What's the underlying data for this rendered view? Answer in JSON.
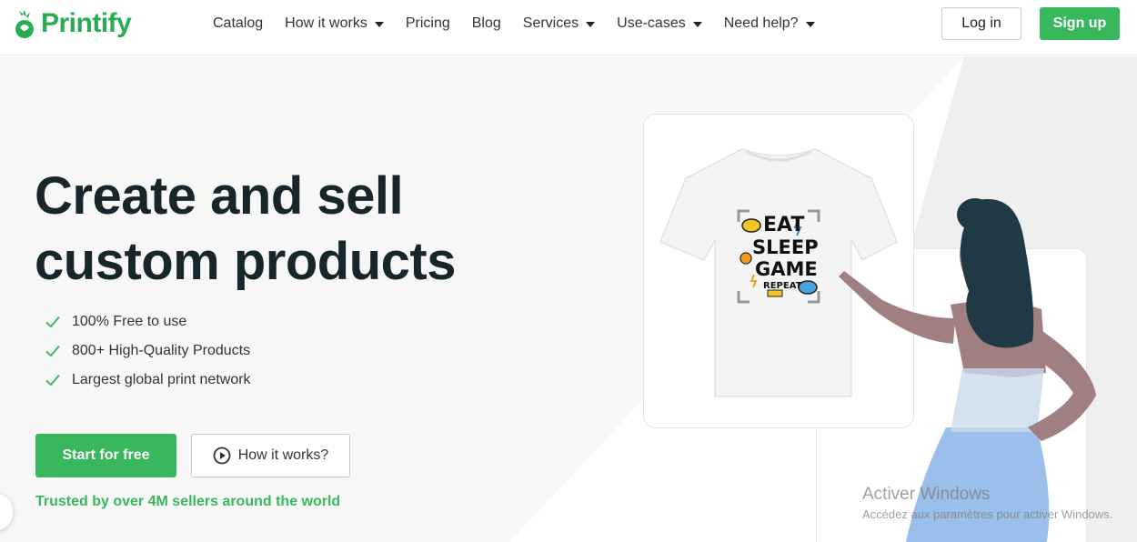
{
  "header": {
    "brand": "Printify",
    "nav": [
      {
        "label": "Catalog",
        "has_dropdown": false
      },
      {
        "label": "How it works",
        "has_dropdown": true
      },
      {
        "label": "Pricing",
        "has_dropdown": false
      },
      {
        "label": "Blog",
        "has_dropdown": false
      },
      {
        "label": "Services",
        "has_dropdown": true
      },
      {
        "label": "Use-cases",
        "has_dropdown": true
      },
      {
        "label": "Need help?",
        "has_dropdown": true
      }
    ],
    "login_label": "Log in",
    "signup_label": "Sign up"
  },
  "hero": {
    "title_line1": "Create and sell",
    "title_line2": "custom products",
    "features": [
      "100% Free to use",
      "800+ High-Quality Products",
      "Largest global print network"
    ],
    "start_label": "Start for free",
    "how_label": "How it works?",
    "trusted_text": "Trusted by over 4M sellers around the world"
  },
  "product": {
    "shirt_design_lines": [
      "EAT",
      "SLEEP",
      "GAME",
      "REPEAT"
    ]
  },
  "watermark": {
    "line1": "Activer Windows",
    "line2": "Accédez aux paramètres pour activer Windows."
  },
  "colors": {
    "brand_green": "#39b75d",
    "text_dark": "#17262b"
  },
  "icons": {
    "feature_check": "check-icon",
    "how_button": "play-circle-icon",
    "logo": "printify-logo-icon"
  }
}
